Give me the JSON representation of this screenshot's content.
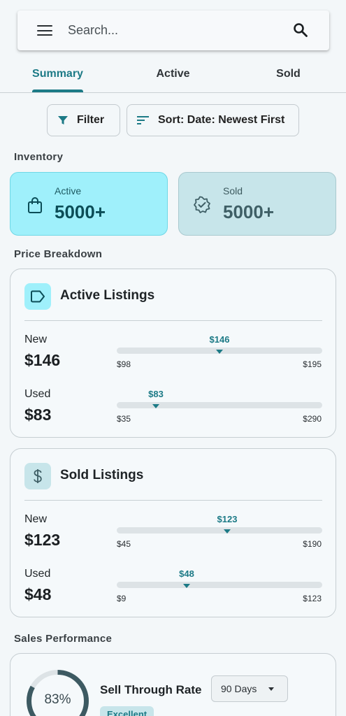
{
  "search": {
    "placeholder": "Search..."
  },
  "tabs": [
    {
      "label": "Summary",
      "active": true
    },
    {
      "label": "Active",
      "active": false
    },
    {
      "label": "Sold",
      "active": false
    }
  ],
  "toolbar": {
    "filter_label": "Filter",
    "sort_label": "Sort: Date: Newest First"
  },
  "inventory": {
    "section_label": "Inventory",
    "active": {
      "label": "Active",
      "value": "5000+"
    },
    "sold": {
      "label": "Sold",
      "value": "5000+"
    }
  },
  "price_breakdown": {
    "section_label": "Price Breakdown",
    "active_listings": {
      "title": "Active Listings",
      "rows": [
        {
          "label": "New",
          "price": "$146",
          "marker": "$146",
          "min": "$98",
          "max": "$195",
          "position": 0.5
        },
        {
          "label": "Used",
          "price": "$83",
          "marker": "$83",
          "min": "$35",
          "max": "$290",
          "position": 0.188
        }
      ]
    },
    "sold_listings": {
      "title": "Sold Listings",
      "rows": [
        {
          "label": "New",
          "price": "$123",
          "marker": "$123",
          "min": "$45",
          "max": "$190",
          "position": 0.538
        },
        {
          "label": "Used",
          "price": "$48",
          "marker": "$48",
          "min": "$9",
          "max": "$123",
          "position": 0.342
        }
      ]
    }
  },
  "sales_performance": {
    "section_label": "Sales Performance",
    "sell_through": {
      "title": "Sell Through Rate",
      "percent_label": "83%",
      "percent": 83,
      "period": "90 Days",
      "rating": "Excellent"
    }
  },
  "colors": {
    "accent": "#1c7a86",
    "active_card_bg": "#9ff0fb",
    "sold_card_bg": "#c7e5ea",
    "gauge_track": "#dde3e6",
    "gauge_fill": "#3d5a62"
  },
  "icons": {
    "menu": "menu-icon",
    "search": "search-icon",
    "filter": "filter-icon",
    "sort": "sort-icon",
    "active": "shopping-bag-icon",
    "sold": "verified-badge-icon",
    "active_listings": "tag-icon",
    "sold_listings": "dollar-icon"
  }
}
